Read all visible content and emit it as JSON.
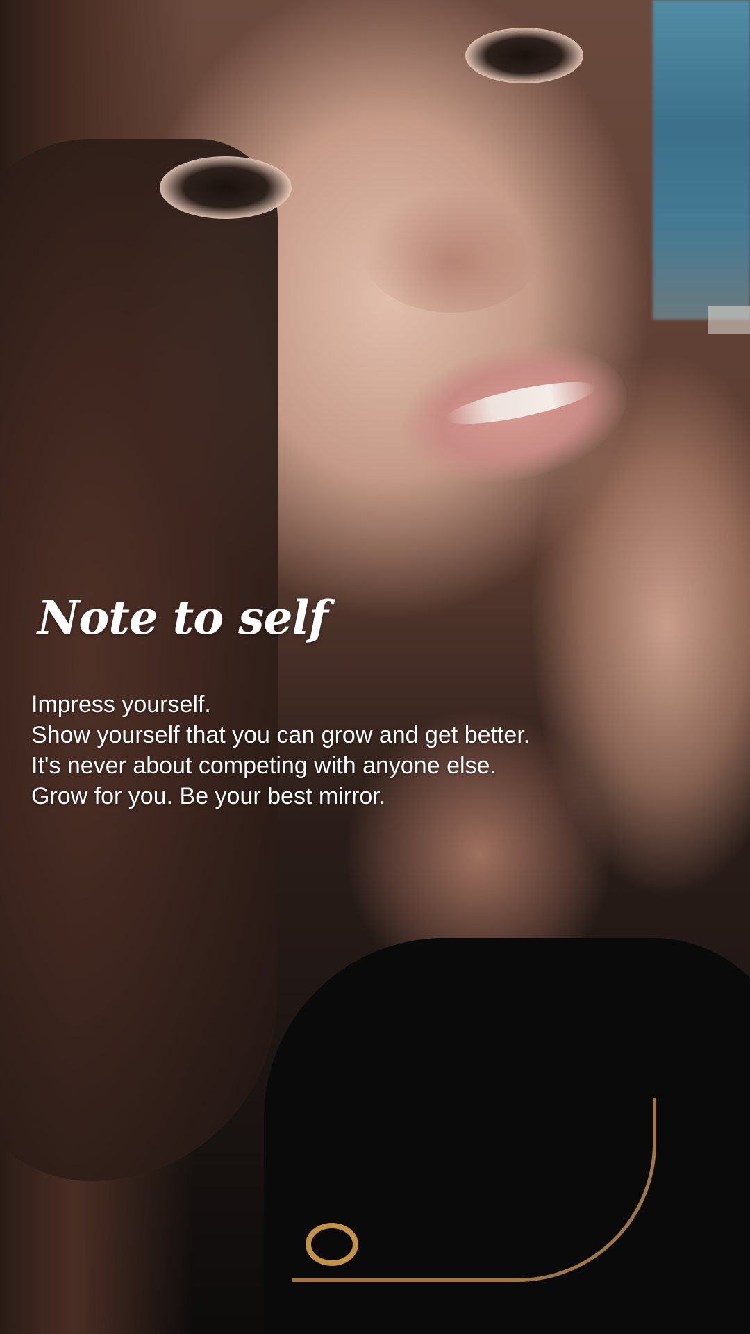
{
  "overlay": {
    "title": "Note to self",
    "lines": [
      "Impress yourself.",
      "Show yourself that you can grow and get better.",
      "It's never about competing with anyone else.",
      "Grow for you. Be your best mirror."
    ]
  },
  "colors": {
    "text": "#ffffff",
    "shirt": "#0b0a0a",
    "necklace": "#d6a24a"
  }
}
